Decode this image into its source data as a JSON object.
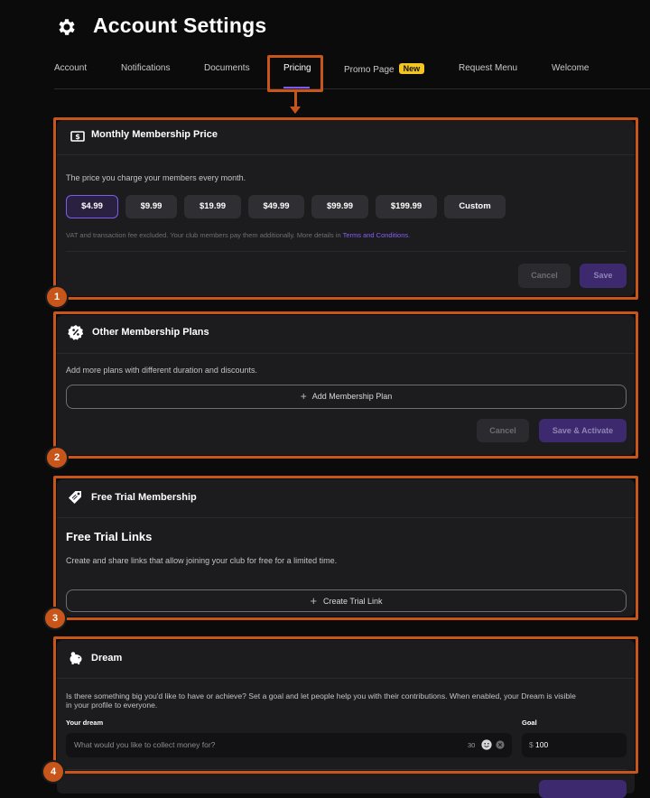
{
  "header": {
    "title": "Account Settings",
    "icon": "gear-icon"
  },
  "tabs": [
    {
      "label": "Account"
    },
    {
      "label": "Notifications"
    },
    {
      "label": "Documents"
    },
    {
      "label": "Pricing",
      "active": true
    },
    {
      "label": "Promo Page",
      "badge": "New"
    },
    {
      "label": "Request Menu"
    },
    {
      "label": "Welcome"
    }
  ],
  "annotations": [
    "1",
    "2",
    "3",
    "4"
  ],
  "monthly": {
    "title": "Monthly Membership Price",
    "icon": "dollar-bill-icon",
    "description": "The price you charge your members every month.",
    "prices": [
      "$4.99",
      "$9.99",
      "$19.99",
      "$49.99",
      "$99.99",
      "$199.99",
      "Custom"
    ],
    "selected": "$4.99",
    "note": "VAT and transaction fee excluded. Your club members pay them additionally. More details in",
    "note_link": "Terms and Conditions",
    "note_end": ".",
    "cancel": "Cancel",
    "save": "Save"
  },
  "other_plans": {
    "title": "Other Membership Plans",
    "icon": "percent-badge-icon",
    "description": "Add more plans with different duration and discounts.",
    "add_button": "Add Membership Plan",
    "cancel": "Cancel",
    "save": "Save & Activate"
  },
  "free_trial": {
    "title": "Free Trial Membership",
    "icon": "tag-icon",
    "heading": "Free Trial Links",
    "description": "Create and share links that allow joining your club for free for a limited time.",
    "create_button": "Create Trial Link"
  },
  "dream": {
    "title": "Dream",
    "icon": "piggy-bank-icon",
    "description_line1": "Is there something big you'd like to have or achieve? Set a goal and let people help you with their contributions. When enabled, your Dream is visible",
    "description_line2": "in your profile to everyone.",
    "dream_label": "Your dream",
    "dream_placeholder": "What would you like to collect money for?",
    "char_count": "30",
    "goal_label": "Goal",
    "goal_currency": "$",
    "goal_value": "100"
  },
  "colors": {
    "accent": "#7c5cf0",
    "annotation": "#c8561b",
    "badge": "#f3c522",
    "link": "#8a5cf6"
  }
}
